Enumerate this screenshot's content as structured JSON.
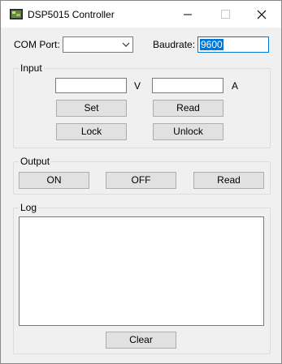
{
  "window": {
    "title": "DSP5015 Controller"
  },
  "connection": {
    "com_port_label": "COM Port:",
    "com_port_value": "",
    "baudrate_label": "Baudrate:",
    "baudrate_value": "9600"
  },
  "input": {
    "title": "Input",
    "voltage_value": "",
    "voltage_unit": "V",
    "current_value": "",
    "current_unit": "A",
    "set_label": "Set",
    "read_label": "Read",
    "lock_label": "Lock",
    "unlock_label": "Unlock"
  },
  "output": {
    "title": "Output",
    "on_label": "ON",
    "off_label": "OFF",
    "read_label": "Read"
  },
  "log": {
    "title": "Log",
    "content": "",
    "clear_label": "Clear"
  },
  "icons": {
    "app": "app-monitor-icon",
    "minimize": "minimize-icon",
    "maximize": "maximize-icon",
    "close": "close-icon",
    "dropdown": "chevron-down-icon"
  }
}
